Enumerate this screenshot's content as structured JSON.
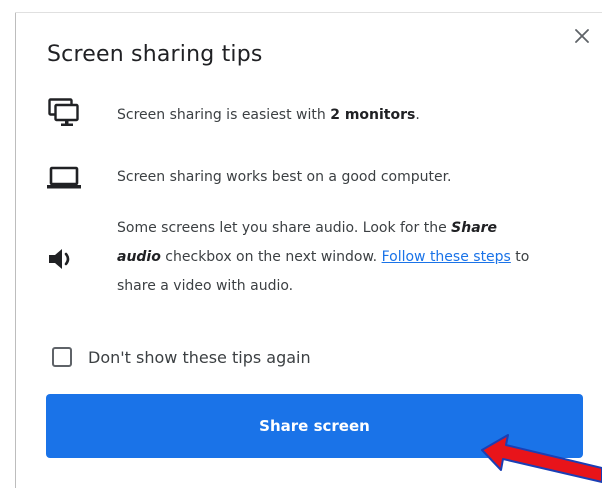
{
  "dialog": {
    "title": "Screen sharing tips",
    "close_icon": "close-icon"
  },
  "tips": [
    {
      "icon": "monitors-icon",
      "text_before": "Screen sharing is easiest with ",
      "text_bold": "2 monitors",
      "text_after": "."
    },
    {
      "icon": "laptop-icon",
      "text": "Screen sharing works best on a good computer."
    },
    {
      "icon": "speaker-icon",
      "text_1": "Some screens let you share audio. Look for the ",
      "bold_italic_1": "Share",
      "bold_italic_2": "audio",
      "text_2": " checkbox on the next window. ",
      "link": "Follow these steps",
      "text_3": " to",
      "text_4": "share a video with audio."
    }
  ],
  "checkbox": {
    "label": "Don't show these tips again",
    "checked": false
  },
  "share_button": {
    "label": "Share screen"
  },
  "colors": {
    "accent": "#1a73e8",
    "annotation_arrow": "#e8141a"
  }
}
